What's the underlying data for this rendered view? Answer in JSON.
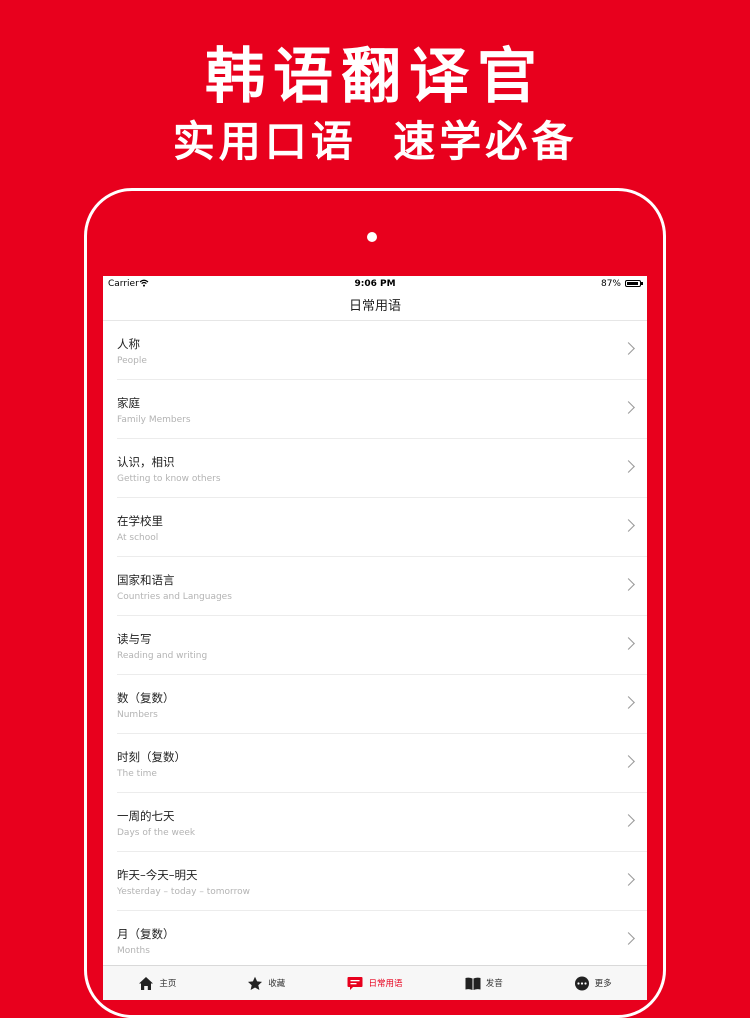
{
  "promo": {
    "title": "韩语翻译官",
    "subtitle": "实用口语 速学必备"
  },
  "status_bar": {
    "carrier": "Carrier",
    "time": "9:06 PM",
    "battery": "87%"
  },
  "nav": {
    "title": "日常用语"
  },
  "items": [
    {
      "title": "人称",
      "subtitle": "People"
    },
    {
      "title": "家庭",
      "subtitle": "Family Members"
    },
    {
      "title": "认识，相识",
      "subtitle": "Getting to know others"
    },
    {
      "title": "在学校里",
      "subtitle": "At school"
    },
    {
      "title": "国家和语言",
      "subtitle": "Countries and Languages"
    },
    {
      "title": "读与写",
      "subtitle": "Reading and writing"
    },
    {
      "title": "数（复数）",
      "subtitle": "Numbers"
    },
    {
      "title": "时刻（复数）",
      "subtitle": "The time"
    },
    {
      "title": "一周的七天",
      "subtitle": "Days of the week"
    },
    {
      "title": "昨天–今天–明天",
      "subtitle": "Yesterday – today – tomorrow"
    },
    {
      "title": "月（复数）",
      "subtitle": "Months"
    }
  ],
  "tabs": [
    {
      "label": "主页",
      "icon": "home-icon"
    },
    {
      "label": "收藏",
      "icon": "star-icon"
    },
    {
      "label": "日常用语",
      "icon": "chat-icon",
      "active": true
    },
    {
      "label": "发音",
      "icon": "book-icon"
    },
    {
      "label": "更多",
      "icon": "more-icon"
    }
  ],
  "colors": {
    "brand_red": "#e8001d",
    "active_tab": "#e8001d"
  }
}
